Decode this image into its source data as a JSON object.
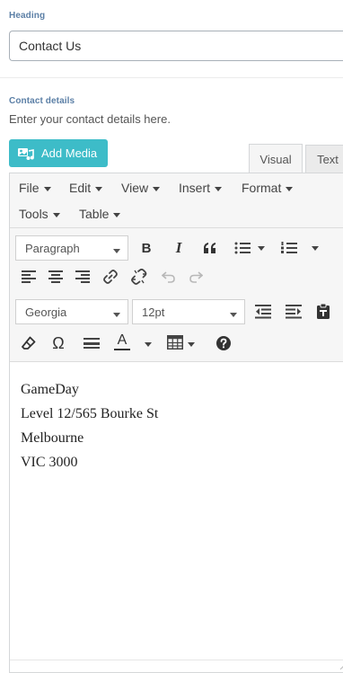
{
  "heading_field": {
    "label": "Heading",
    "value": "Contact Us"
  },
  "contact_field": {
    "label": "Contact details",
    "description": "Enter your contact details here."
  },
  "media_button": {
    "label": "Add Media",
    "icon": "add-media-icon"
  },
  "tabs": {
    "visual": "Visual",
    "text": "Text"
  },
  "menubar": {
    "file": "File",
    "edit": "Edit",
    "view": "View",
    "insert": "Insert",
    "format": "Format",
    "tools": "Tools",
    "table": "Table"
  },
  "toolbar": {
    "block_format": "Paragraph",
    "font_family": "Georgia",
    "font_size": "12pt",
    "bold": "B",
    "italic": "I",
    "underline_color_letter": "A",
    "special_char": "Ω"
  },
  "content_lines": [
    "GameDay",
    "Level 12/565 Bourke St",
    "Melbourne",
    "VIC 3000"
  ],
  "colors": {
    "accent": "#3dbcc8",
    "label": "#5b7fa6",
    "toolbar_bg": "#f6f6f6"
  }
}
